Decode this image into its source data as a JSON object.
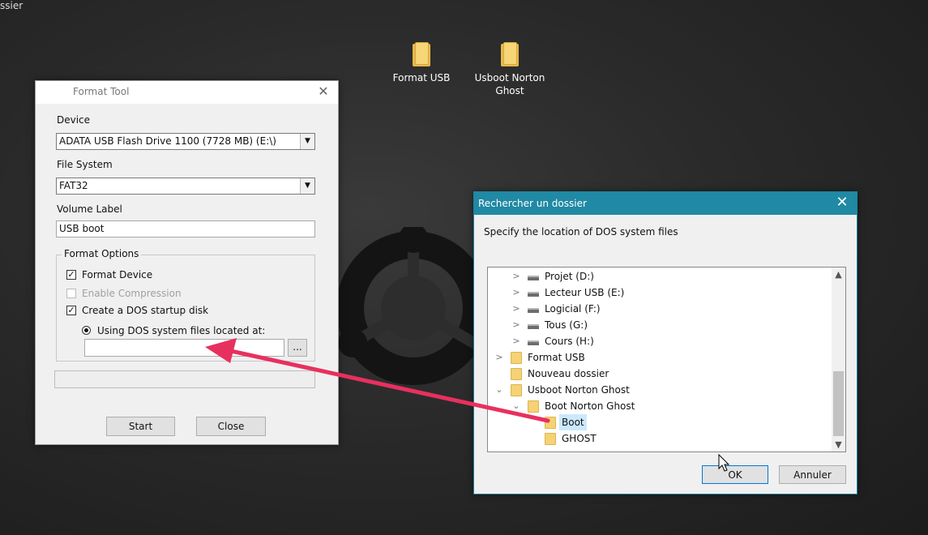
{
  "desktop": {
    "corner_text": "ssier",
    "icons": [
      {
        "label": "Format USB",
        "icon": "folder-icon"
      },
      {
        "label": "Usboot Norton Ghost",
        "icon": "folder-icon"
      }
    ]
  },
  "format_tool": {
    "title": "Format Tool",
    "device_label": "Device",
    "device_value": "ADATA USB Flash Drive 1100 (7728 MB) (E:\\)",
    "filesystem_label": "File System",
    "filesystem_value": "FAT32",
    "volume_label": "Volume Label",
    "volume_value": "USB boot",
    "options_title": "Format Options",
    "format_device": "Format Device",
    "enable_compression": "Enable Compression",
    "create_dos": "Create a DOS startup disk",
    "using_dos_files": "Using DOS system files located at:",
    "dos_path_value": "",
    "browse_btn": "...",
    "start_btn": "Start",
    "close_btn": "Close"
  },
  "browse_dialog": {
    "title": "Rechercher un dossier",
    "instruction": "Specify the location of DOS system files",
    "tree": [
      {
        "label": "Projet (D:)",
        "icon": "drive-icon",
        "expander": ">"
      },
      {
        "label": "Lecteur USB (E:)",
        "icon": "drive-icon",
        "expander": ">"
      },
      {
        "label": "Logicial (F:)",
        "icon": "drive-icon",
        "expander": ">"
      },
      {
        "label": "Tous (G:)",
        "icon": "drive-icon",
        "expander": ">"
      },
      {
        "label": "Cours (H:)",
        "icon": "drive-icon",
        "expander": ">"
      },
      {
        "label": "Format USB",
        "icon": "folder-icon",
        "expander": ">"
      },
      {
        "label": "Nouveau dossier",
        "icon": "folder-icon",
        "expander": ""
      },
      {
        "label": "Usboot Norton Ghost",
        "icon": "folder-icon",
        "expander": "v"
      },
      {
        "label": "Boot Norton Ghost",
        "icon": "folder-icon",
        "expander": "v"
      },
      {
        "label": "Boot",
        "icon": "folder-icon",
        "expander": "",
        "selected": true
      },
      {
        "label": "GHOST",
        "icon": "folder-icon",
        "expander": ""
      }
    ],
    "ok_btn": "OK",
    "cancel_btn": "Annuler"
  },
  "colors": {
    "accent_titlebar": "#2089a4",
    "annotation_arrow": "#e8305f",
    "selection": "#cce8ff"
  }
}
